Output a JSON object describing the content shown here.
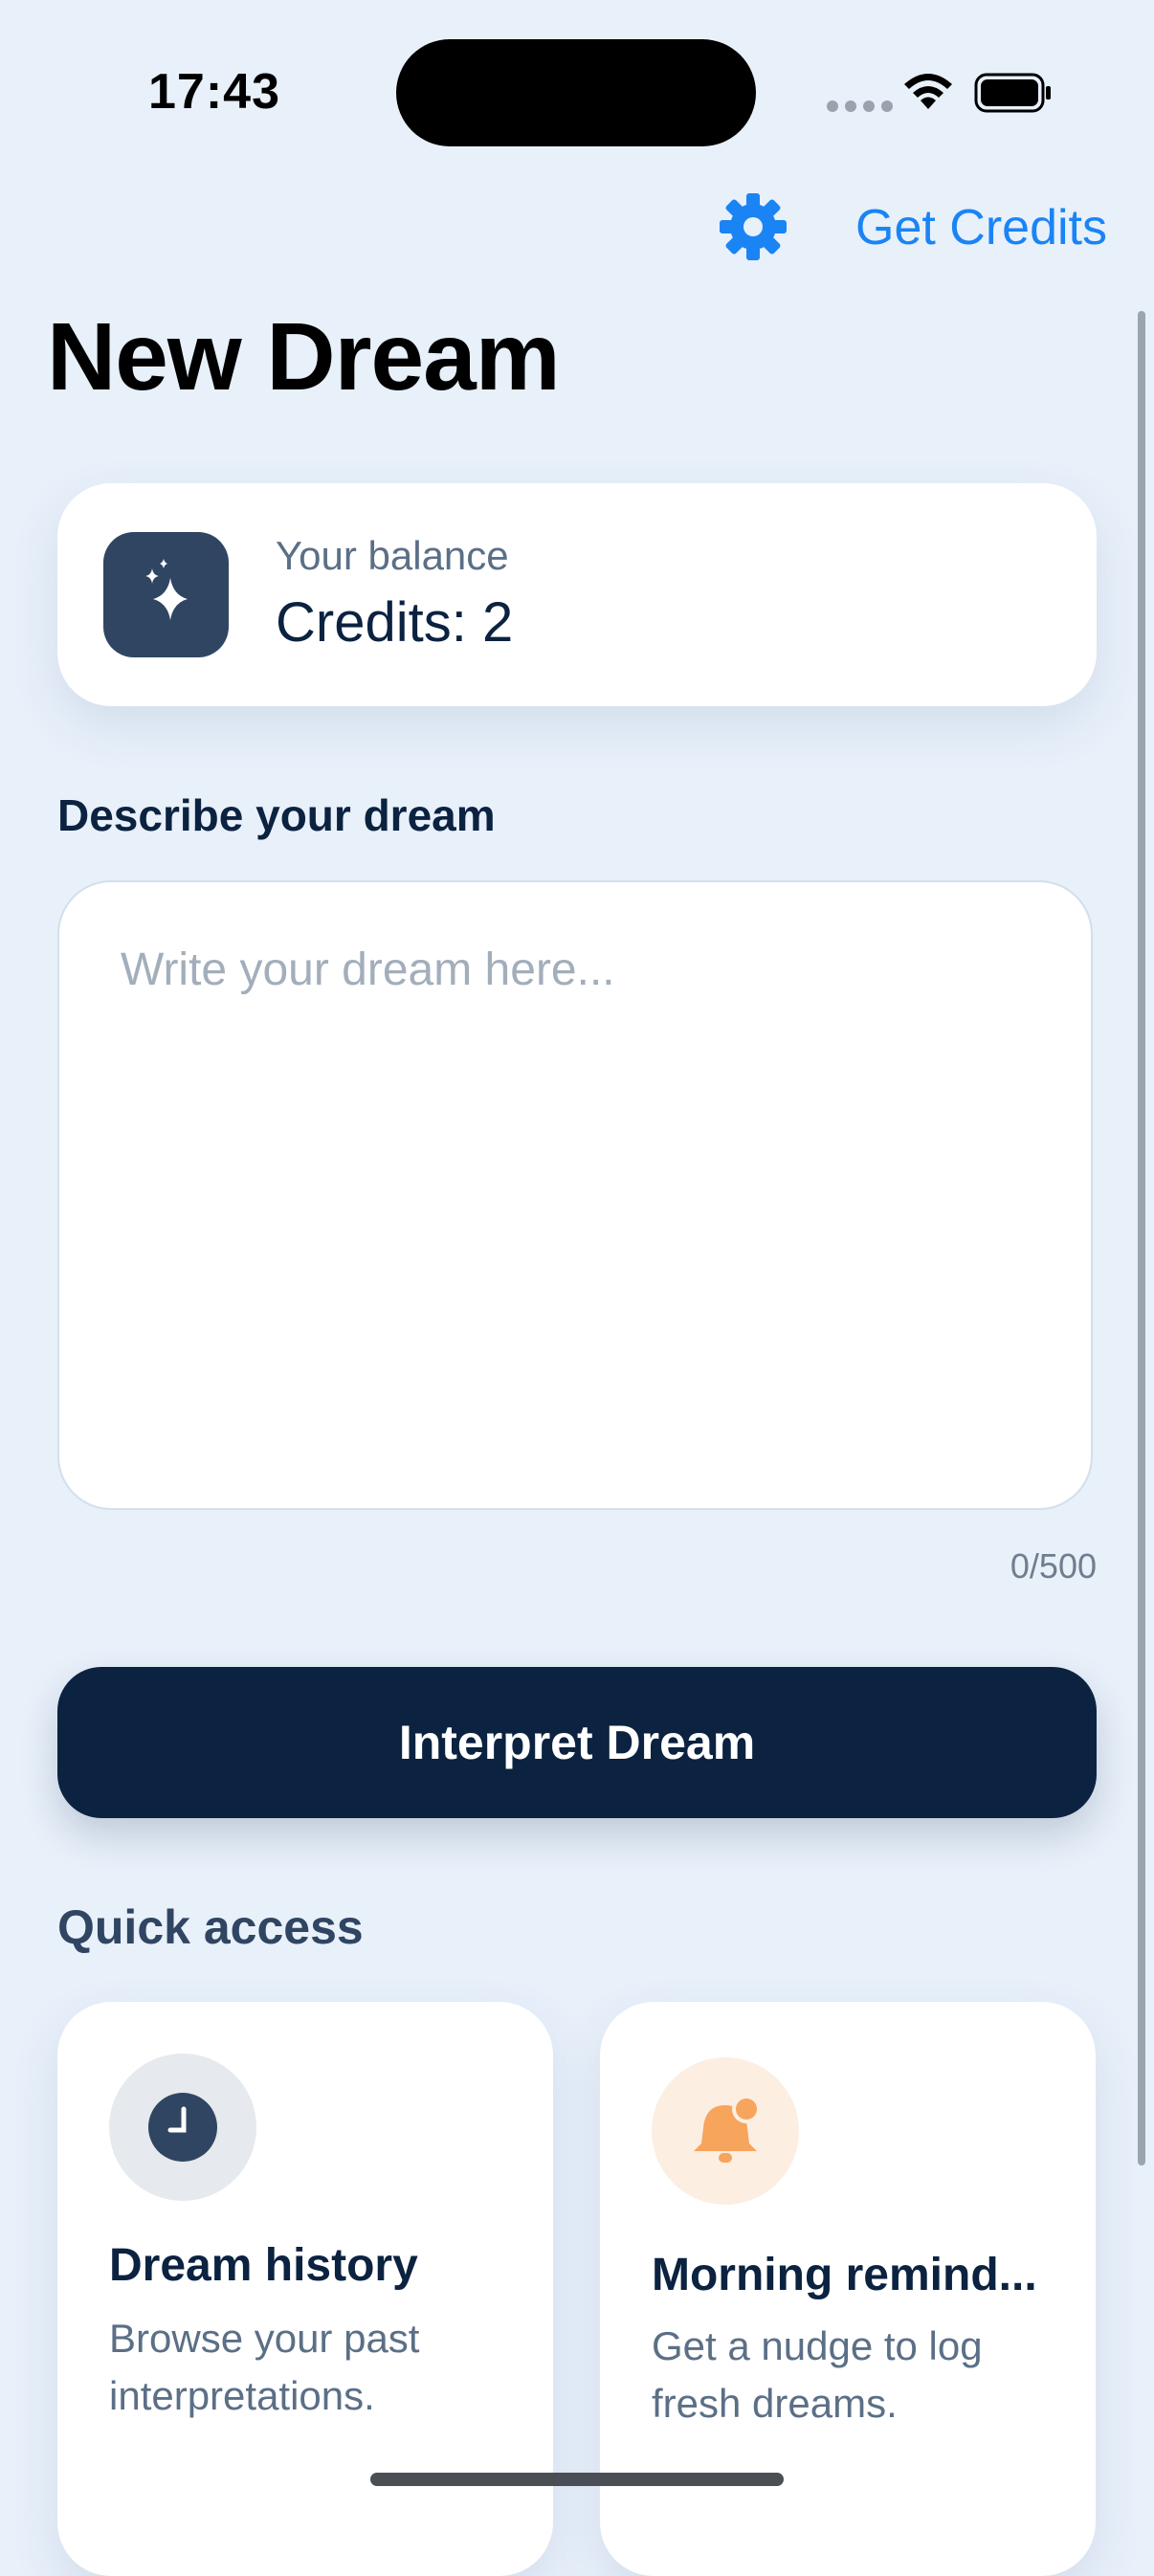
{
  "status_bar": {
    "time": "17:43"
  },
  "nav": {
    "get_credits": "Get Credits"
  },
  "page": {
    "title": "New Dream"
  },
  "balance": {
    "label": "Your balance",
    "value": "Credits: 2"
  },
  "dream": {
    "label": "Describe your dream",
    "placeholder": "Write your dream here...",
    "counter": "0/500"
  },
  "actions": {
    "interpret": "Interpret Dream"
  },
  "quick_access": {
    "label": "Quick access",
    "items": [
      {
        "title": "Dream history",
        "subtitle": "Browse your past interpretations."
      },
      {
        "title": "Morning remind...",
        "subtitle": "Get a nudge to log fresh dreams."
      }
    ]
  },
  "colors": {
    "background": "#e8f0fa",
    "accent": "#1a84f5",
    "primary_button": "#0b2240",
    "reminder_icon": "#f7a45c"
  },
  "icons": {
    "settings": "gear-icon",
    "balance": "sparkles-icon",
    "history": "clock-icon",
    "reminder": "bell-icon"
  }
}
